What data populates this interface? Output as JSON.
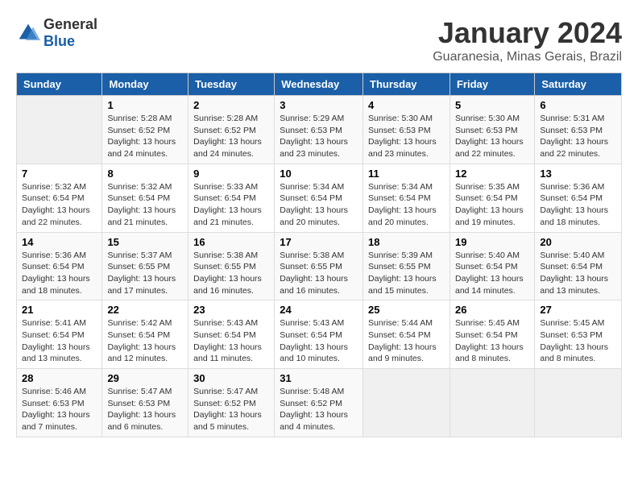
{
  "header": {
    "logo_general": "General",
    "logo_blue": "Blue",
    "month_year": "January 2024",
    "location": "Guaranesia, Minas Gerais, Brazil"
  },
  "days_of_week": [
    "Sunday",
    "Monday",
    "Tuesday",
    "Wednesday",
    "Thursday",
    "Friday",
    "Saturday"
  ],
  "weeks": [
    [
      {
        "day": "",
        "empty": true
      },
      {
        "day": "1",
        "sunrise": "5:28 AM",
        "sunset": "6:52 PM",
        "daylight": "13 hours and 24 minutes."
      },
      {
        "day": "2",
        "sunrise": "5:28 AM",
        "sunset": "6:52 PM",
        "daylight": "13 hours and 24 minutes."
      },
      {
        "day": "3",
        "sunrise": "5:29 AM",
        "sunset": "6:53 PM",
        "daylight": "13 hours and 23 minutes."
      },
      {
        "day": "4",
        "sunrise": "5:30 AM",
        "sunset": "6:53 PM",
        "daylight": "13 hours and 23 minutes."
      },
      {
        "day": "5",
        "sunrise": "5:30 AM",
        "sunset": "6:53 PM",
        "daylight": "13 hours and 22 minutes."
      },
      {
        "day": "6",
        "sunrise": "5:31 AM",
        "sunset": "6:53 PM",
        "daylight": "13 hours and 22 minutes."
      }
    ],
    [
      {
        "day": "7",
        "sunrise": "5:32 AM",
        "sunset": "6:54 PM",
        "daylight": "13 hours and 22 minutes."
      },
      {
        "day": "8",
        "sunrise": "5:32 AM",
        "sunset": "6:54 PM",
        "daylight": "13 hours and 21 minutes."
      },
      {
        "day": "9",
        "sunrise": "5:33 AM",
        "sunset": "6:54 PM",
        "daylight": "13 hours and 21 minutes."
      },
      {
        "day": "10",
        "sunrise": "5:34 AM",
        "sunset": "6:54 PM",
        "daylight": "13 hours and 20 minutes."
      },
      {
        "day": "11",
        "sunrise": "5:34 AM",
        "sunset": "6:54 PM",
        "daylight": "13 hours and 20 minutes."
      },
      {
        "day": "12",
        "sunrise": "5:35 AM",
        "sunset": "6:54 PM",
        "daylight": "13 hours and 19 minutes."
      },
      {
        "day": "13",
        "sunrise": "5:36 AM",
        "sunset": "6:54 PM",
        "daylight": "13 hours and 18 minutes."
      }
    ],
    [
      {
        "day": "14",
        "sunrise": "5:36 AM",
        "sunset": "6:54 PM",
        "daylight": "13 hours and 18 minutes."
      },
      {
        "day": "15",
        "sunrise": "5:37 AM",
        "sunset": "6:55 PM",
        "daylight": "13 hours and 17 minutes."
      },
      {
        "day": "16",
        "sunrise": "5:38 AM",
        "sunset": "6:55 PM",
        "daylight": "13 hours and 16 minutes."
      },
      {
        "day": "17",
        "sunrise": "5:38 AM",
        "sunset": "6:55 PM",
        "daylight": "13 hours and 16 minutes."
      },
      {
        "day": "18",
        "sunrise": "5:39 AM",
        "sunset": "6:55 PM",
        "daylight": "13 hours and 15 minutes."
      },
      {
        "day": "19",
        "sunrise": "5:40 AM",
        "sunset": "6:54 PM",
        "daylight": "13 hours and 14 minutes."
      },
      {
        "day": "20",
        "sunrise": "5:40 AM",
        "sunset": "6:54 PM",
        "daylight": "13 hours and 13 minutes."
      }
    ],
    [
      {
        "day": "21",
        "sunrise": "5:41 AM",
        "sunset": "6:54 PM",
        "daylight": "13 hours and 13 minutes."
      },
      {
        "day": "22",
        "sunrise": "5:42 AM",
        "sunset": "6:54 PM",
        "daylight": "13 hours and 12 minutes."
      },
      {
        "day": "23",
        "sunrise": "5:43 AM",
        "sunset": "6:54 PM",
        "daylight": "13 hours and 11 minutes."
      },
      {
        "day": "24",
        "sunrise": "5:43 AM",
        "sunset": "6:54 PM",
        "daylight": "13 hours and 10 minutes."
      },
      {
        "day": "25",
        "sunrise": "5:44 AM",
        "sunset": "6:54 PM",
        "daylight": "13 hours and 9 minutes."
      },
      {
        "day": "26",
        "sunrise": "5:45 AM",
        "sunset": "6:54 PM",
        "daylight": "13 hours and 8 minutes."
      },
      {
        "day": "27",
        "sunrise": "5:45 AM",
        "sunset": "6:53 PM",
        "daylight": "13 hours and 8 minutes."
      }
    ],
    [
      {
        "day": "28",
        "sunrise": "5:46 AM",
        "sunset": "6:53 PM",
        "daylight": "13 hours and 7 minutes."
      },
      {
        "day": "29",
        "sunrise": "5:47 AM",
        "sunset": "6:53 PM",
        "daylight": "13 hours and 6 minutes."
      },
      {
        "day": "30",
        "sunrise": "5:47 AM",
        "sunset": "6:52 PM",
        "daylight": "13 hours and 5 minutes."
      },
      {
        "day": "31",
        "sunrise": "5:48 AM",
        "sunset": "6:52 PM",
        "daylight": "13 hours and 4 minutes."
      },
      {
        "day": "",
        "empty": true
      },
      {
        "day": "",
        "empty": true
      },
      {
        "day": "",
        "empty": true
      }
    ]
  ]
}
